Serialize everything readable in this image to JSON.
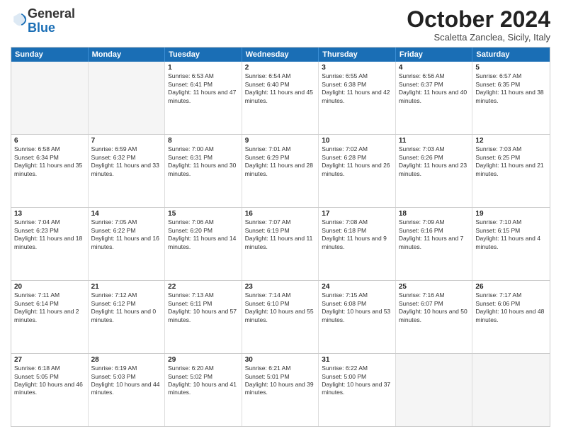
{
  "header": {
    "logo": {
      "line1": "General",
      "line2": "Blue"
    },
    "title": "October 2024",
    "subtitle": "Scaletta Zanclea, Sicily, Italy"
  },
  "weekdays": [
    "Sunday",
    "Monday",
    "Tuesday",
    "Wednesday",
    "Thursday",
    "Friday",
    "Saturday"
  ],
  "rows": [
    [
      {
        "day": "",
        "info": ""
      },
      {
        "day": "",
        "info": ""
      },
      {
        "day": "1",
        "info": "Sunrise: 6:53 AM\nSunset: 6:41 PM\nDaylight: 11 hours and 47 minutes."
      },
      {
        "day": "2",
        "info": "Sunrise: 6:54 AM\nSunset: 6:40 PM\nDaylight: 11 hours and 45 minutes."
      },
      {
        "day": "3",
        "info": "Sunrise: 6:55 AM\nSunset: 6:38 PM\nDaylight: 11 hours and 42 minutes."
      },
      {
        "day": "4",
        "info": "Sunrise: 6:56 AM\nSunset: 6:37 PM\nDaylight: 11 hours and 40 minutes."
      },
      {
        "day": "5",
        "info": "Sunrise: 6:57 AM\nSunset: 6:35 PM\nDaylight: 11 hours and 38 minutes."
      }
    ],
    [
      {
        "day": "6",
        "info": "Sunrise: 6:58 AM\nSunset: 6:34 PM\nDaylight: 11 hours and 35 minutes."
      },
      {
        "day": "7",
        "info": "Sunrise: 6:59 AM\nSunset: 6:32 PM\nDaylight: 11 hours and 33 minutes."
      },
      {
        "day": "8",
        "info": "Sunrise: 7:00 AM\nSunset: 6:31 PM\nDaylight: 11 hours and 30 minutes."
      },
      {
        "day": "9",
        "info": "Sunrise: 7:01 AM\nSunset: 6:29 PM\nDaylight: 11 hours and 28 minutes."
      },
      {
        "day": "10",
        "info": "Sunrise: 7:02 AM\nSunset: 6:28 PM\nDaylight: 11 hours and 26 minutes."
      },
      {
        "day": "11",
        "info": "Sunrise: 7:03 AM\nSunset: 6:26 PM\nDaylight: 11 hours and 23 minutes."
      },
      {
        "day": "12",
        "info": "Sunrise: 7:03 AM\nSunset: 6:25 PM\nDaylight: 11 hours and 21 minutes."
      }
    ],
    [
      {
        "day": "13",
        "info": "Sunrise: 7:04 AM\nSunset: 6:23 PM\nDaylight: 11 hours and 18 minutes."
      },
      {
        "day": "14",
        "info": "Sunrise: 7:05 AM\nSunset: 6:22 PM\nDaylight: 11 hours and 16 minutes."
      },
      {
        "day": "15",
        "info": "Sunrise: 7:06 AM\nSunset: 6:20 PM\nDaylight: 11 hours and 14 minutes."
      },
      {
        "day": "16",
        "info": "Sunrise: 7:07 AM\nSunset: 6:19 PM\nDaylight: 11 hours and 11 minutes."
      },
      {
        "day": "17",
        "info": "Sunrise: 7:08 AM\nSunset: 6:18 PM\nDaylight: 11 hours and 9 minutes."
      },
      {
        "day": "18",
        "info": "Sunrise: 7:09 AM\nSunset: 6:16 PM\nDaylight: 11 hours and 7 minutes."
      },
      {
        "day": "19",
        "info": "Sunrise: 7:10 AM\nSunset: 6:15 PM\nDaylight: 11 hours and 4 minutes."
      }
    ],
    [
      {
        "day": "20",
        "info": "Sunrise: 7:11 AM\nSunset: 6:14 PM\nDaylight: 11 hours and 2 minutes."
      },
      {
        "day": "21",
        "info": "Sunrise: 7:12 AM\nSunset: 6:12 PM\nDaylight: 11 hours and 0 minutes."
      },
      {
        "day": "22",
        "info": "Sunrise: 7:13 AM\nSunset: 6:11 PM\nDaylight: 10 hours and 57 minutes."
      },
      {
        "day": "23",
        "info": "Sunrise: 7:14 AM\nSunset: 6:10 PM\nDaylight: 10 hours and 55 minutes."
      },
      {
        "day": "24",
        "info": "Sunrise: 7:15 AM\nSunset: 6:08 PM\nDaylight: 10 hours and 53 minutes."
      },
      {
        "day": "25",
        "info": "Sunrise: 7:16 AM\nSunset: 6:07 PM\nDaylight: 10 hours and 50 minutes."
      },
      {
        "day": "26",
        "info": "Sunrise: 7:17 AM\nSunset: 6:06 PM\nDaylight: 10 hours and 48 minutes."
      }
    ],
    [
      {
        "day": "27",
        "info": "Sunrise: 6:18 AM\nSunset: 5:05 PM\nDaylight: 10 hours and 46 minutes."
      },
      {
        "day": "28",
        "info": "Sunrise: 6:19 AM\nSunset: 5:03 PM\nDaylight: 10 hours and 44 minutes."
      },
      {
        "day": "29",
        "info": "Sunrise: 6:20 AM\nSunset: 5:02 PM\nDaylight: 10 hours and 41 minutes."
      },
      {
        "day": "30",
        "info": "Sunrise: 6:21 AM\nSunset: 5:01 PM\nDaylight: 10 hours and 39 minutes."
      },
      {
        "day": "31",
        "info": "Sunrise: 6:22 AM\nSunset: 5:00 PM\nDaylight: 10 hours and 37 minutes."
      },
      {
        "day": "",
        "info": ""
      },
      {
        "day": "",
        "info": ""
      }
    ]
  ]
}
